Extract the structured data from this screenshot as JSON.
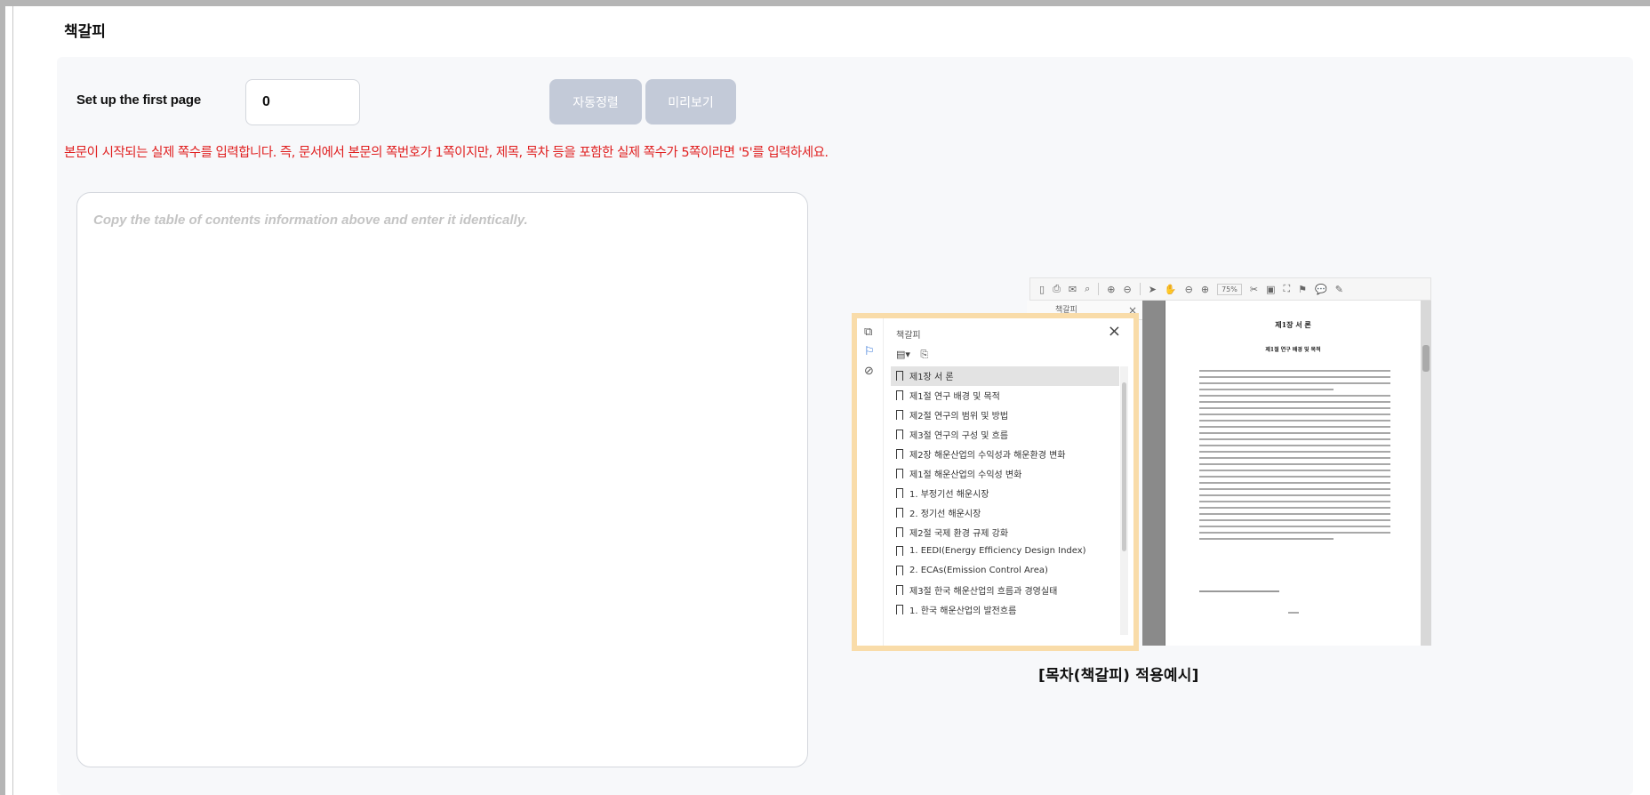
{
  "section": {
    "title": "책갈피"
  },
  "first_page": {
    "label": "Set up the first page",
    "value": "0"
  },
  "buttons": {
    "auto_sort": "자동정렬",
    "preview": "미리보기"
  },
  "notice": "본문이 시작되는 실제 쪽수를 입력합니다. 즉, 문서에서 본문의 쪽번호가 1쪽이지만, 제목, 목차 등을 포함한 실제 쪽수가 5쪽이라면 '5'를 입력하세요.",
  "toc_input": {
    "value": "",
    "placeholder": "Copy the table of contents information above and enter it identically."
  },
  "example": {
    "viewer_header": "책갈피",
    "panel_title": "책갈피",
    "zoom": "75%",
    "doc_title": "제1장 서 론",
    "doc_subtitle": "제1절 연구 배경 및 목적",
    "bookmarks": [
      "제1장 서 론",
      "제1절 연구 배경 및 목적",
      "제2절 연구의 범위 및 방법",
      "제3절 연구의 구성 및 흐름",
      "제2장 해운산업의 수익성과 해운환경 변화",
      "제1절 해운산업의 수익성 변화",
      "1. 부정기선 해운시장",
      "2. 정기선 해운시장",
      "제2절 국제 환경 규제 강화",
      "1. EEDI(Energy Efficiency Design Index)",
      "2. ECAs(Emission Control Area)",
      "제3절 한국 해운산업의 흐름과 경영실태",
      "1. 한국 해운산업의 발전흐름"
    ],
    "caption": "[목차(책갈피) 적용예시]"
  }
}
